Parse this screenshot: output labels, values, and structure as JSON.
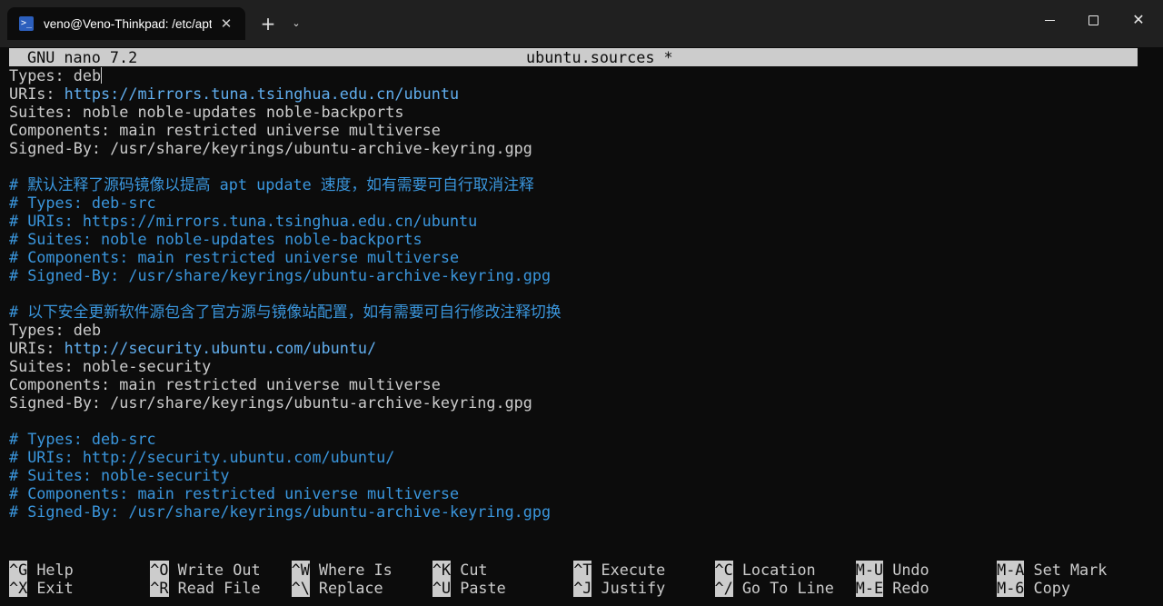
{
  "window": {
    "tab_title": "veno@Veno-Thinkpad: /etc/apt",
    "tab_icon": "powershell-icon",
    "tab_close": "✕",
    "new_tab": "+",
    "dropdown": "⌄",
    "minimize": "minimize-icon",
    "maximize": "maximize-icon",
    "close": "✕"
  },
  "nano": {
    "app": "GNU nano 7.2",
    "filename": "ubuntu.sources *"
  },
  "file_lines": [
    {
      "key": "Types: ",
      "val": "deb",
      "kind": "plain"
    },
    {
      "key": "URIs: ",
      "val": "https://mirrors.tuna.tsinghua.edu.cn/ubuntu",
      "kind": "url"
    },
    {
      "key": "Suites: ",
      "val": "noble noble-updates noble-backports",
      "kind": "plain"
    },
    {
      "key": "Components: ",
      "val": "main restricted universe multiverse",
      "kind": "plain"
    },
    {
      "key": "Signed-By: ",
      "val": "/usr/share/keyrings/ubuntu-archive-keyring.gpg",
      "kind": "plain"
    },
    {
      "key": "",
      "val": "",
      "kind": "blank"
    },
    {
      "key": "",
      "val": "# 默认注释了源码镜像以提高 apt update 速度，如有需要可自行取消注释",
      "kind": "comment"
    },
    {
      "key": "",
      "val": "# Types: deb-src",
      "kind": "comment"
    },
    {
      "key": "",
      "val": "# URIs: https://mirrors.tuna.tsinghua.edu.cn/ubuntu",
      "kind": "comment"
    },
    {
      "key": "",
      "val": "# Suites: noble noble-updates noble-backports",
      "kind": "comment"
    },
    {
      "key": "",
      "val": "# Components: main restricted universe multiverse",
      "kind": "comment"
    },
    {
      "key": "",
      "val": "# Signed-By: /usr/share/keyrings/ubuntu-archive-keyring.gpg",
      "kind": "comment"
    },
    {
      "key": "",
      "val": "",
      "kind": "blank"
    },
    {
      "key": "",
      "val": "# 以下安全更新软件源包含了官方源与镜像站配置，如有需要可自行修改注释切换",
      "kind": "comment"
    },
    {
      "key": "Types: ",
      "val": "deb",
      "kind": "plain"
    },
    {
      "key": "URIs: ",
      "val": "http://security.ubuntu.com/ubuntu/",
      "kind": "url"
    },
    {
      "key": "Suites: ",
      "val": "noble-security",
      "kind": "plain"
    },
    {
      "key": "Components: ",
      "val": "main restricted universe multiverse",
      "kind": "plain"
    },
    {
      "key": "Signed-By: ",
      "val": "/usr/share/keyrings/ubuntu-archive-keyring.gpg",
      "kind": "plain"
    },
    {
      "key": "",
      "val": "",
      "kind": "blank"
    },
    {
      "key": "",
      "val": "# Types: deb-src",
      "kind": "comment"
    },
    {
      "key": "",
      "val": "# URIs: http://security.ubuntu.com/ubuntu/",
      "kind": "comment"
    },
    {
      "key": "",
      "val": "# Suites: noble-security",
      "kind": "comment"
    },
    {
      "key": "",
      "val": "# Components: main restricted universe multiverse",
      "kind": "comment"
    },
    {
      "key": "",
      "val": "# Signed-By: /usr/share/keyrings/ubuntu-archive-keyring.gpg",
      "kind": "comment"
    }
  ],
  "shortcuts": [
    {
      "key": "^G",
      "label": "Help"
    },
    {
      "key": "^X",
      "label": "Exit"
    },
    {
      "key": "^O",
      "label": "Write Out"
    },
    {
      "key": "^R",
      "label": "Read File"
    },
    {
      "key": "^W",
      "label": "Where Is"
    },
    {
      "key": "^\\",
      "label": "Replace"
    },
    {
      "key": "^K",
      "label": "Cut"
    },
    {
      "key": "^U",
      "label": "Paste"
    },
    {
      "key": "^T",
      "label": "Execute"
    },
    {
      "key": "^J",
      "label": "Justify"
    },
    {
      "key": "^C",
      "label": "Location"
    },
    {
      "key": "^/",
      "label": "Go To Line"
    },
    {
      "key": "M-U",
      "label": "Undo"
    },
    {
      "key": "M-E",
      "label": "Redo"
    },
    {
      "key": "M-A",
      "label": "Set Mark"
    },
    {
      "key": "M-6",
      "label": "Copy"
    }
  ],
  "colors": {
    "background": "#0c0c0c",
    "text": "#cccccc",
    "url": "#61aeee",
    "comment": "#3a96dd",
    "titlebar": "#202020"
  }
}
